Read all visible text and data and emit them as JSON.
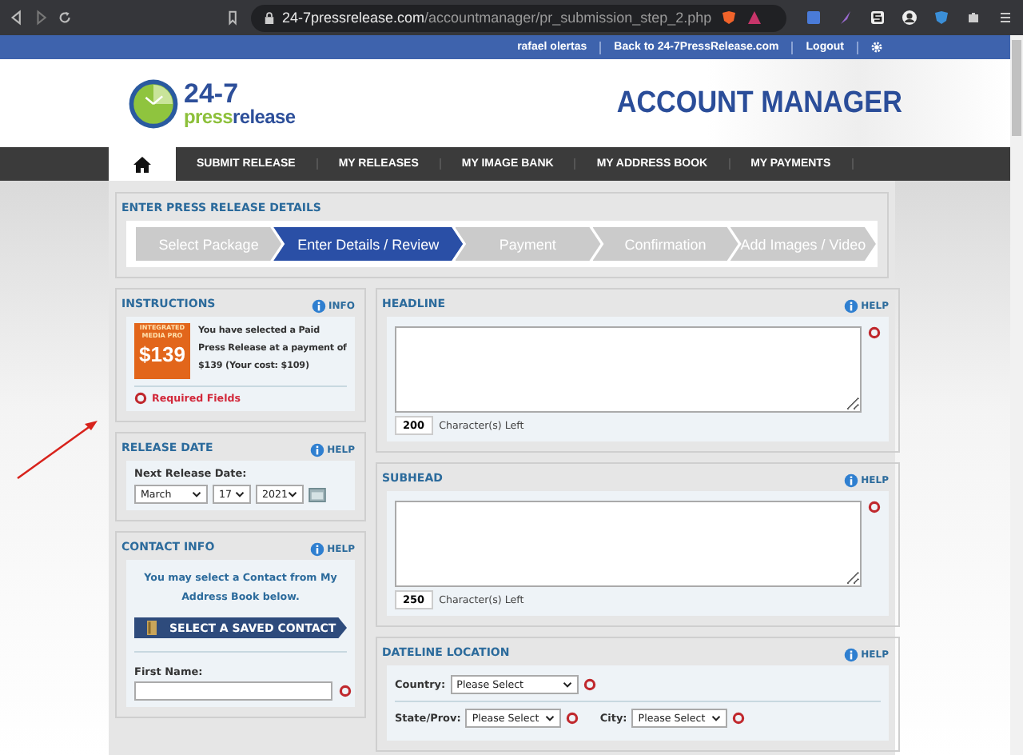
{
  "browser": {
    "url_host": "24-7pressrelease.com",
    "url_path": "/accountmanager/pr_submission_step_2.php"
  },
  "topbar": {
    "links": [
      "rafael olertas",
      "Back to 24-7PressRelease.com",
      "Logout"
    ]
  },
  "header": {
    "logo_number": "24-7",
    "logo_press": "press",
    "logo_release": "release",
    "title": "ACCOUNT MANAGER"
  },
  "nav": {
    "items": [
      "SUBMIT RELEASE",
      "MY RELEASES",
      "MY IMAGE BANK",
      "MY ADDRESS BOOK",
      "MY PAYMENTS"
    ]
  },
  "details": {
    "legend": "ENTER PRESS RELEASE DETAILS",
    "steps": [
      {
        "label": "Select Package",
        "selected": false
      },
      {
        "label": "Enter Details / Review",
        "selected": true
      },
      {
        "label": "Payment",
        "selected": false
      },
      {
        "label": "Confirmation",
        "selected": false
      },
      {
        "label": "Add Images / Video",
        "selected": false
      }
    ]
  },
  "instructions": {
    "legend": "INSTRUCTIONS",
    "help": "INFO",
    "badge_line1": "INTEGRATED",
    "badge_line2": "MEDIA PRO",
    "badge_price": "$139",
    "text": "You have selected a Paid Press Release at a payment of $139 (Your cost: $109)",
    "required": "Required Fields"
  },
  "release_date": {
    "legend": "RELEASE DATE",
    "help": "HELP",
    "label": "Next Release Date:",
    "month": "March",
    "day": "17",
    "year": "2021"
  },
  "contact": {
    "legend": "CONTACT INFO",
    "help": "HELP",
    "text": "You may select a Contact from My Address Book below.",
    "button": "SELECT A SAVED CONTACT",
    "first_name_label": "First Name:"
  },
  "headline": {
    "legend": "HEADLINE",
    "help": "HELP",
    "count": "200",
    "count_label": "Character(s) Left"
  },
  "subhead": {
    "legend": "SUBHEAD",
    "help": "HELP",
    "count": "250",
    "count_label": "Character(s) Left"
  },
  "dateline": {
    "legend": "DATELINE LOCATION",
    "help": "HELP",
    "country_label": "Country:",
    "country_value": "Please Select",
    "state_label": "State/Prov:",
    "state_value": "Please Select",
    "city_label": "City:",
    "city_value": "Please Select"
  }
}
